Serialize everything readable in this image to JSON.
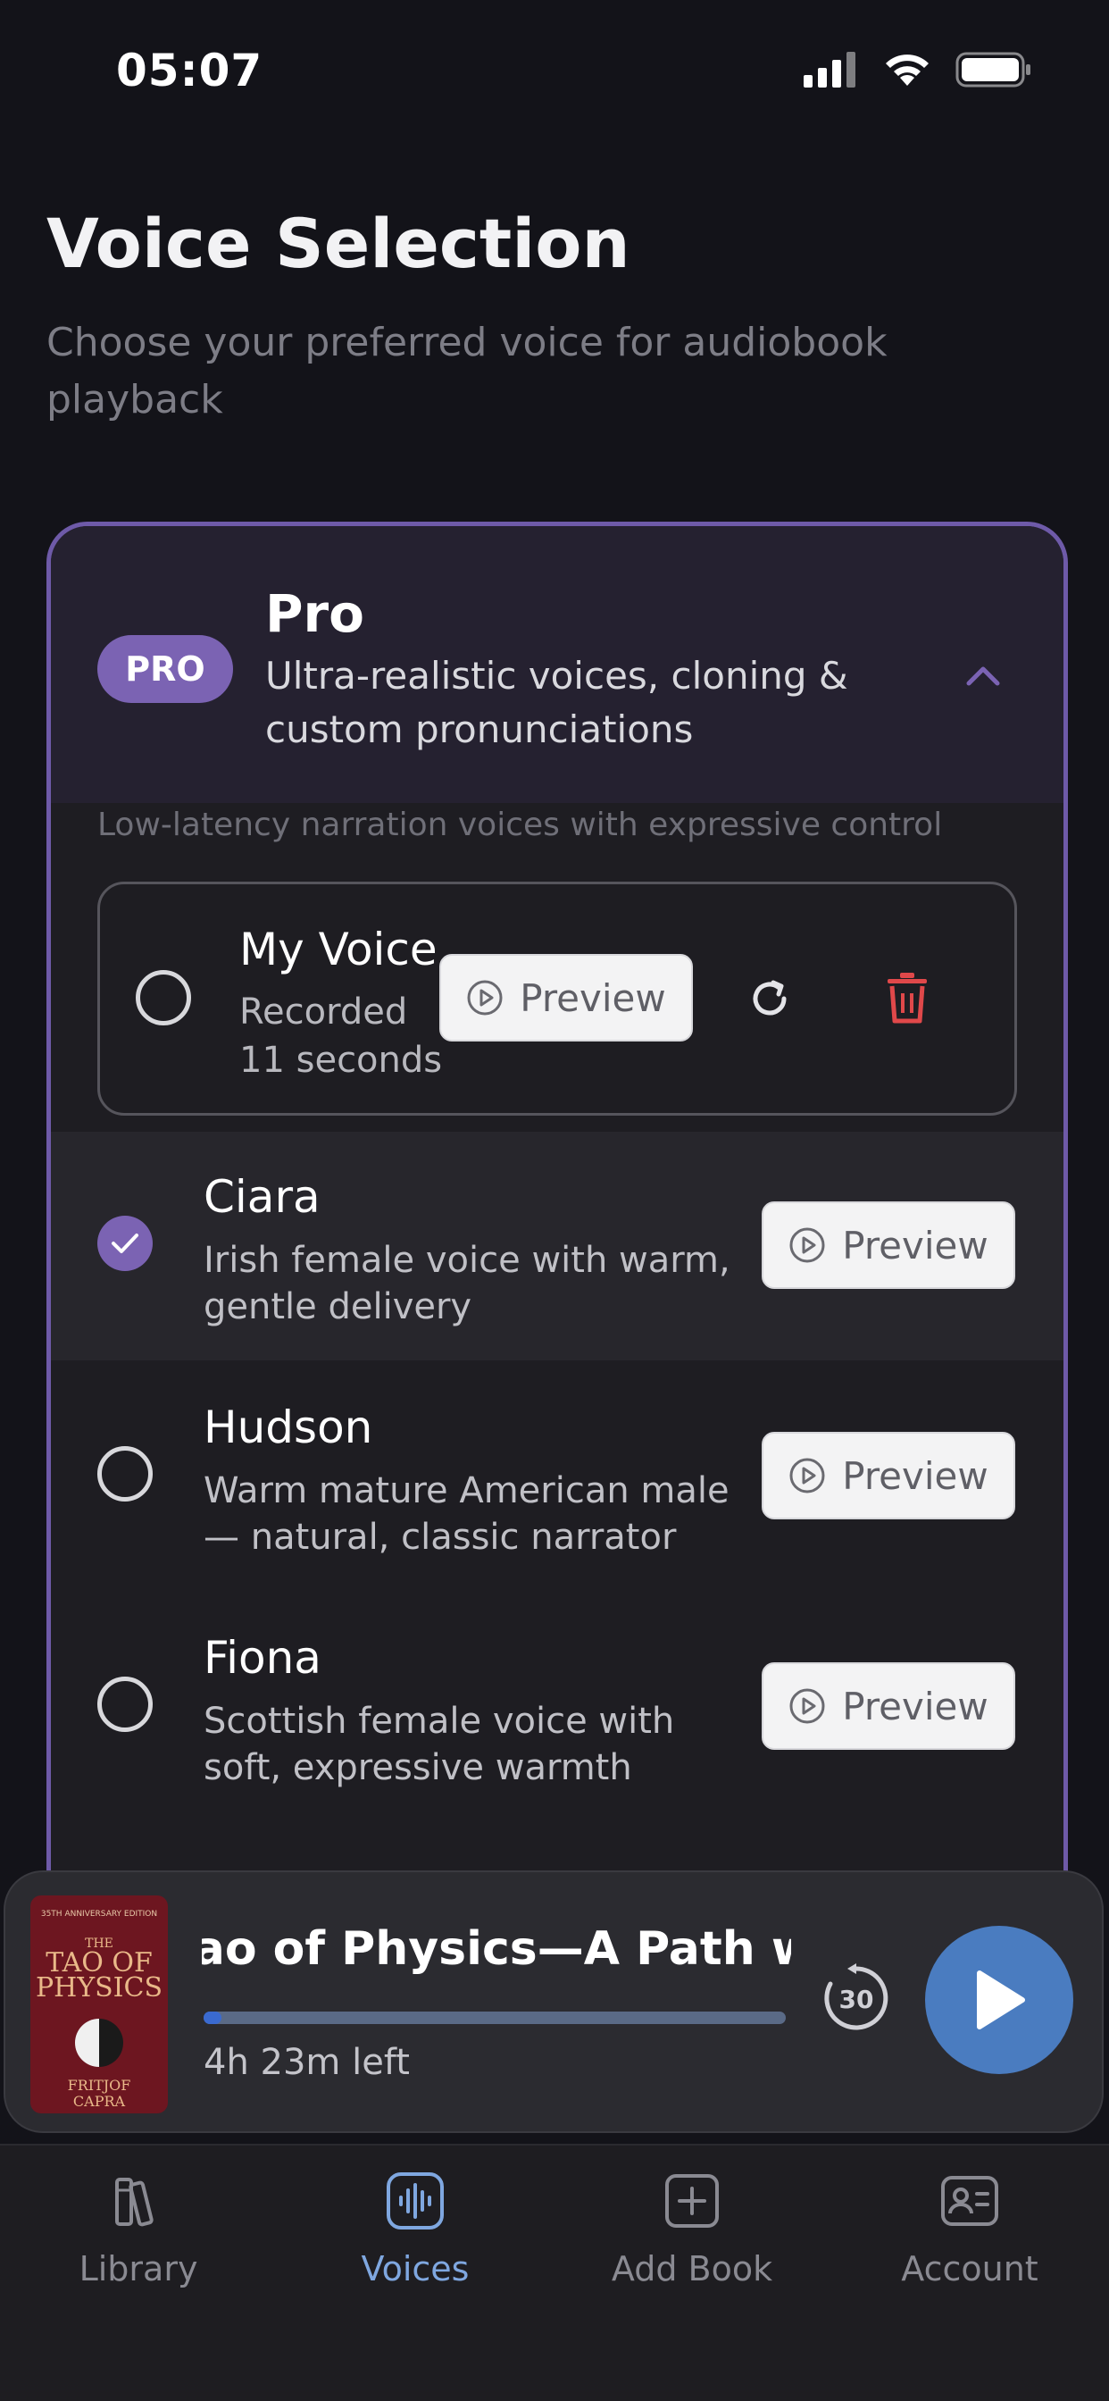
{
  "status_bar": {
    "time": "05:07"
  },
  "header": {
    "title": "Voice Selection",
    "subtitle": "Choose your preferred voice for audiobook playback"
  },
  "tier": {
    "badge": "PRO",
    "title": "Pro",
    "description": "Ultra-realistic voices, cloning & custom pronunciations",
    "note": "Low-latency narration voices with expressive control",
    "expanded": true
  },
  "my_voice": {
    "name": "My Voice",
    "status": "Recorded",
    "duration": "11 seconds",
    "preview_label": "Preview",
    "selected": false
  },
  "voices": [
    {
      "name": "Ciara",
      "description": "Irish female voice with warm, gentle delivery",
      "preview_label": "Preview",
      "selected": true
    },
    {
      "name": "Hudson",
      "description": "Warm mature American male — natural, classic narrator",
      "preview_label": "Preview",
      "selected": false
    },
    {
      "name": "Fiona",
      "description": "Scottish female voice with soft, expressive warmth",
      "preview_label": "Preview",
      "selected": false
    }
  ],
  "player": {
    "title": "Tao of Physics—A Path with a H",
    "time_left": "4h 23m left",
    "progress": 0.03,
    "skip_seconds": "30",
    "cover": {
      "edition": "35TH ANNIVERSARY EDITION",
      "title_line1": "THE",
      "title_line2": "TAO OF",
      "title_line3": "PHYSICS",
      "author_line1": "FRITJOF",
      "author_line2": "CAPRA"
    }
  },
  "tabs": [
    {
      "label": "Library",
      "icon": "library-icon",
      "active": false
    },
    {
      "label": "Voices",
      "icon": "voices-icon",
      "active": true
    },
    {
      "label": "Add Book",
      "icon": "add-book-icon",
      "active": false
    },
    {
      "label": "Account",
      "icon": "account-icon",
      "active": false
    }
  ],
  "colors": {
    "accent": "#7b63b3",
    "play_button": "#4a7cc0",
    "active_tab": "#7fa7e0",
    "delete": "#e0484a"
  }
}
